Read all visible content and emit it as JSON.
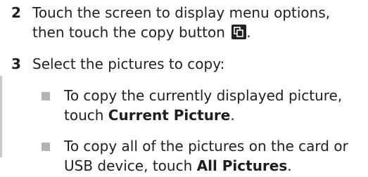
{
  "step2": {
    "number": "2",
    "text_before_icon": "Touch the screen to display menu options, then touch the copy button",
    "text_after_icon": ".",
    "icon": "copy-icon"
  },
  "step3": {
    "number": "3",
    "text": "Select the pictures to copy:",
    "bullets": [
      {
        "text_before": "To copy the currently displayed picture, touch ",
        "bold": "Current Picture",
        "text_after": "."
      },
      {
        "text_before": "To copy all of the pictures on the card or USB device, touch ",
        "bold": "All Pictures",
        "text_after": "."
      }
    ]
  }
}
